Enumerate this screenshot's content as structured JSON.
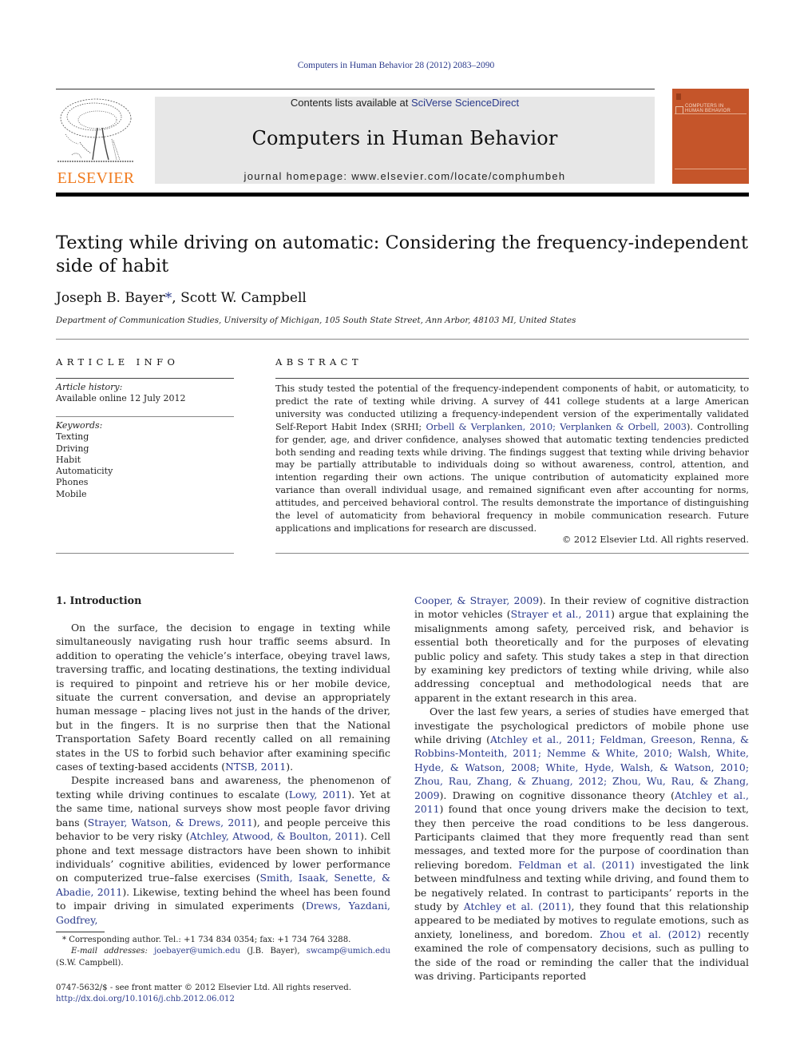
{
  "running_head": "Computers in Human Behavior 28 (2012) 2083–2090",
  "publisher": {
    "logo_word": "ELSEVIER",
    "logo_color": "#f07a1d"
  },
  "banner": {
    "contents_prefix": "Contents lists available at ",
    "contents_link": "SciVerse ScienceDirect",
    "journal_title": "Computers in Human Behavior",
    "homepage": "journal homepage: www.elsevier.com/locate/comphumbeh"
  },
  "cover": {
    "title_line1": "COMPUTERS IN",
    "title_line2": "HUMAN BEHAVIOR",
    "color": "#c5552a"
  },
  "article": {
    "title": "Texting while driving on automatic: Considering the frequency-independent side of habit",
    "author1": "Joseph B. Bayer",
    "author1_mark": "*",
    "author_sep": ", ",
    "author2": "Scott W. Campbell",
    "affiliation": "Department of Communication Studies, University of Michigan, 105 South State Street, Ann Arbor, 48103 MI, United States"
  },
  "article_info": {
    "heading": "ARTICLE INFO",
    "history_label": "Article history:",
    "history_value": "Available online 12 July 2012",
    "keywords_label": "Keywords:",
    "keywords": [
      "Texting",
      "Driving",
      "Habit",
      "Automaticity",
      "Phones",
      "Mobile"
    ]
  },
  "abstract": {
    "heading": "ABSTRACT",
    "text_a": "This study tested the potential of the frequency-independent components of habit, or automaticity, to predict the rate of texting while driving. A survey of 441 college students at a large American university was conducted utilizing a frequency-independent version of the experimentally validated Self-Report Habit Index (SRHI; ",
    "cite_1": "Orbell & Verplanken, 2010; Verplanken & Orbell, 2003",
    "text_b": "). Controlling for gender, age, and driver confidence, analyses showed that automatic texting tendencies predicted both sending and reading texts while driving. The findings suggest that texting while driving behavior may be partially attributable to individuals doing so without awareness, control, attention, and intention regarding their own actions. The unique contribution of automaticity explained more variance than overall individual usage, and remained significant even after accounting for norms, attitudes, and perceived behavioral control. The results demonstrate the importance of distinguishing the level of automaticity from behavioral frequency in mobile communication research. Future applications and implications for research are discussed.",
    "copyright": "© 2012 Elsevier Ltd. All rights reserved."
  },
  "body": {
    "section_heading": "1. Introduction",
    "p1": "On the surface, the decision to engage in texting while simultaneously navigating rush hour traffic seems absurd. In addition to operating the vehicle’s interface, obeying travel laws, traversing traffic, and locating destinations, the texting individual is required to pinpoint and retrieve his or her mobile device, situate the current conversation, and devise an appropriately human message – placing lives not just in the hands of the driver, but in the fingers. It is no surprise then that the National Transportation Safety Board recently called on all remaining states in the US to forbid such behavior after examining specific cases of texting-based accidents (",
    "p1_cite": "NTSB, 2011",
    "p1_end": ").",
    "p2_a": "Despite increased bans and awareness, the phenomenon of texting while driving continues to escalate (",
    "p2_cite1": "Lowy, 2011",
    "p2_b": "). Yet at the same time, national surveys show most people favor driving bans (",
    "p2_cite2": "Strayer, Watson, & Drews, 2011",
    "p2_c": "), and people perceive this behavior to be very risky (",
    "p2_cite3": "Atchley, Atwood, & Boulton, 2011",
    "p2_d": "). Cell phone and text message distractors have been shown to inhibit individuals’ cognitive abilities, evidenced by lower performance on computerized true–false exercises (",
    "p2_cite4": "Smith, Isaak, Senette, & Abadie, 2011",
    "p2_e": "). Likewise, texting behind the wheel has been found to impair driving in simulated experiments (",
    "p2_cite5a": "Drews, Yazdani, Godfrey,",
    "r1_cite5b": "Cooper, & Strayer, 2009",
    "r1_a": "). In their review of cognitive distraction in motor vehicles (",
    "r1_cite6": "Strayer et al., 2011",
    "r1_b": ") argue that explaining the misalignments among safety, perceived risk, and behavior is essential both theoretically and for the purposes of elevating public policy and safety. This study takes a step in that direction by examining key predictors of texting while driving, while also addressing conceptual and methodological needs that are apparent in the extant research in this area.",
    "r2_a": "Over the last few years, a series of studies have emerged that investigate the psychological predictors of mobile phone use while driving (",
    "r2_cite1": "Atchley et al., 2011; Feldman, Greeson, Renna, & Robbins-Monteith, 2011; Nemme & White, 2010; Walsh, White, Hyde, & Watson, 2008; White, Hyde, Walsh, & Watson, 2010; Zhou, Rau, Zhang, & Zhuang, 2012; Zhou, Wu, Rau, & Zhang, 2009",
    "r2_b": "). Drawing on cognitive dissonance theory (",
    "r2_cite2": "Atchley et al., 2011",
    "r2_c": ") found that once young drivers make the decision to text, they then perceive the road conditions to be less dangerous. Participants claimed that they more frequently read than sent messages, and texted more for the purpose of coordination than relieving boredom. ",
    "r2_cite3": "Feldman et al. (2011)",
    "r2_d": " investigated the link between mindfulness and texting while driving, and found them to be negatively related. In contrast to participants’ reports in the study by ",
    "r2_cite4": "Atchley et al. (2011)",
    "r2_e": ", they found that this relationship appeared to be mediated by motives to regulate emotions, such as anxiety, loneliness, and boredom. ",
    "r2_cite5": "Zhou et al. (2012)",
    "r2_f": " recently examined the role of compensatory decisions, such as pulling to the side of the road or reminding the caller that the individual was driving. Participants reported"
  },
  "footnote": {
    "mark": "*",
    "corresponding": " Corresponding author. Tel.: +1 734 834 0354; fax: +1 734 764 3288.",
    "email_label": "E-mail addresses:",
    "email1": "joebayer@umich.edu",
    "email1_who": " (J.B. Bayer), ",
    "email2": "swcamp@umich.edu",
    "email2_who": " (S.W. Campbell)."
  },
  "front_matter": {
    "issn_line": "0747-5632/$ - see front matter © 2012 Elsevier Ltd. All rights reserved.",
    "doi": "http://dx.doi.org/10.1016/j.chb.2012.06.012"
  },
  "colors": {
    "link": "#2a3a8c",
    "banner_bg": "#e7e7e7"
  }
}
